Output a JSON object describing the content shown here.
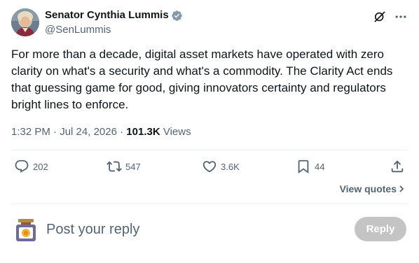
{
  "author": {
    "display_name": "Senator Cynthia Lummis",
    "handle": "@SenLummis"
  },
  "tweet": {
    "text": "For more than a decade, digital asset markets have operated with zero clarity on what's a security and what's a commodity. The Clarity Act ends that guessing game for good, giving innovators certainty and regulators bright lines to enforce.",
    "time": "1:32 PM",
    "date": "Jul 24, 2026",
    "views_count": "101.3K",
    "views_label": "Views"
  },
  "actions": {
    "replies": "202",
    "reposts": "547",
    "likes": "3.6K",
    "bookmarks": "44"
  },
  "view_quotes_label": "View quotes",
  "composer": {
    "placeholder": "Post your reply",
    "button_label": "Reply"
  },
  "colors": {
    "text": "#0f1419",
    "muted": "#536471",
    "verified": "#829aab",
    "divider": "#eff3f4",
    "reply_button_disabled": "#c4c4c4"
  },
  "icons": {
    "verified": "verified-badge-icon",
    "grok": "grok-icon",
    "more": "more-icon",
    "reply": "reply-icon",
    "repost": "repost-icon",
    "like": "heart-icon",
    "bookmark": "bookmark-icon",
    "share": "share-icon",
    "chevron": "chevron-right-icon"
  }
}
